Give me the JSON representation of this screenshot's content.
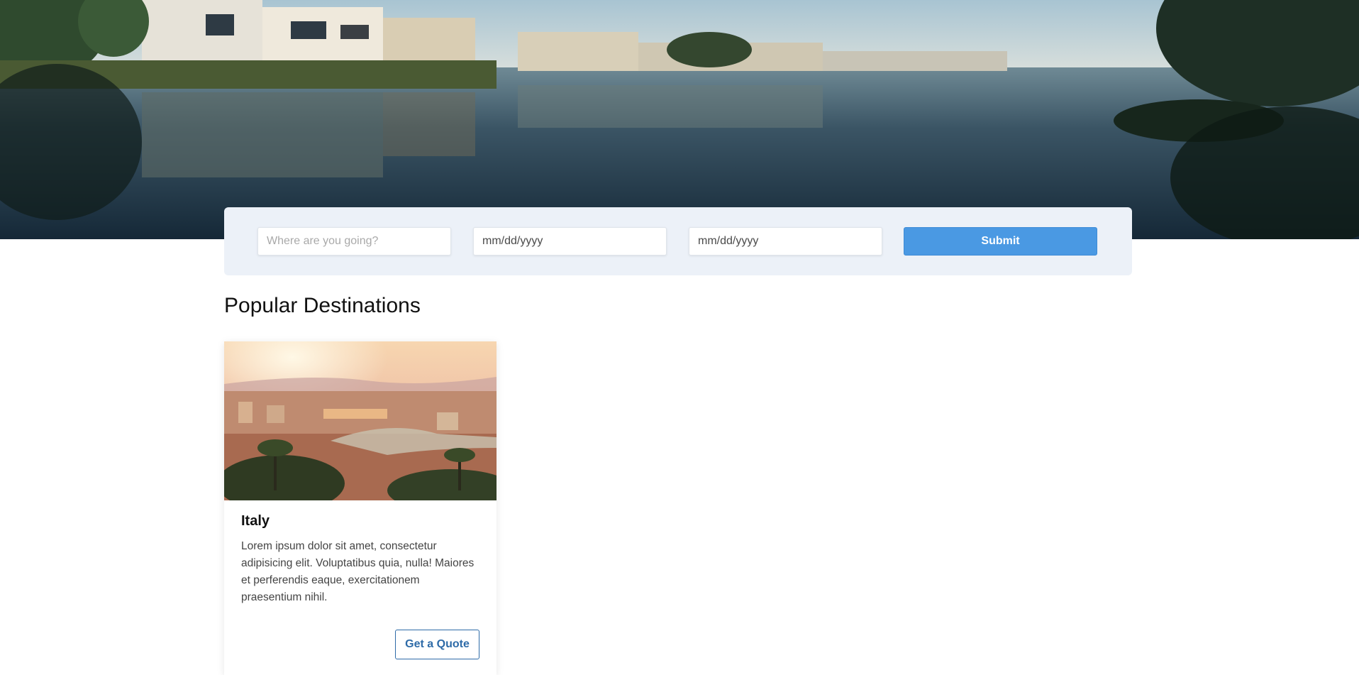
{
  "hero": {
    "image": "waterfront-houses-reflection-photo"
  },
  "search": {
    "destination_placeholder": "Where are you going?",
    "destination_value": "",
    "check_in_value": "mm/dd/yyyy",
    "check_out_value": "mm/dd/yyyy",
    "submit_label": "Submit"
  },
  "destinations": {
    "heading": "Popular Destinations",
    "cards": [
      {
        "image": "florence-sunset-cityscape-photo",
        "title": "Italy",
        "description": "Lorem ipsum dolor sit amet, consectetur adipisicing elit. Voluptatibus quia, nulla! Maiores et perferendis eaque, exercitationem praesentium nihil.",
        "button_label": "Get a Quote"
      }
    ]
  },
  "colors": {
    "submit_bg": "#4a99e3",
    "panel_bg": "#ecf1f8",
    "quote_border": "#2e6ba8"
  }
}
